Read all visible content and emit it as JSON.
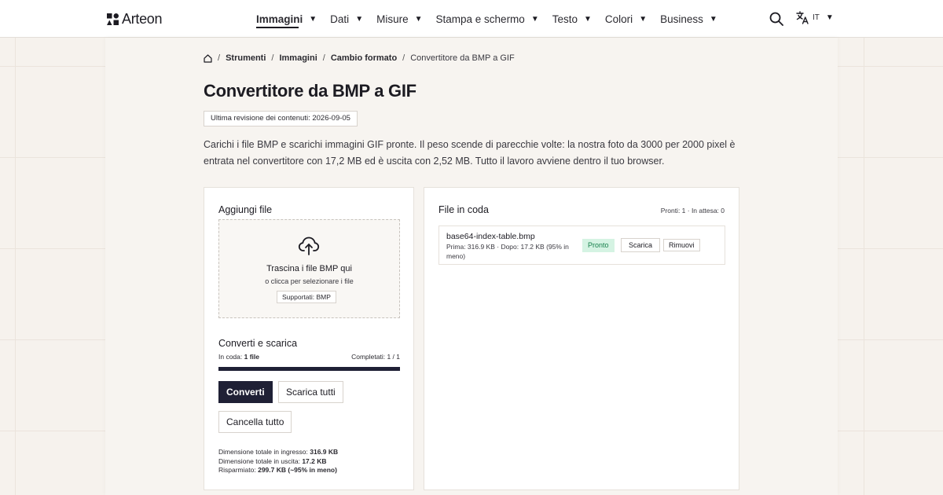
{
  "header": {
    "brand": "Arteon",
    "nav": [
      {
        "label": "Immagini",
        "active": true
      },
      {
        "label": "Dati"
      },
      {
        "label": "Misure"
      },
      {
        "label": "Stampa e schermo"
      },
      {
        "label": "Testo"
      },
      {
        "label": "Colori"
      },
      {
        "label": "Business"
      }
    ],
    "caret": "▼",
    "language": "IT",
    "icons": {
      "search": "search-icon",
      "translate": "translate-icon",
      "home": "home-icon"
    }
  },
  "breadcrumb": {
    "separator": "/",
    "items": [
      "Strumenti",
      "Immagini",
      "Cambio formato"
    ],
    "current": "Convertitore da BMP a GIF"
  },
  "page": {
    "title": "Convertitore da BMP a GIF",
    "revision": "Ultima revisione dei contenuti: 2026-09-05",
    "intro": "Carichi i file BMP e scarichi immagini GIF pronte. Il peso scende di parecchie volte: la nostra foto da 3000 per 2000 pixel è entrata nel convertitore con 17,2 MB ed è uscita con 2,52 MB. Tutto il lavoro avviene dentro il tuo browser."
  },
  "upload": {
    "title": "Aggiungi file",
    "drop_main": "Trascina i file BMP qui",
    "drop_sub": "o clicca per selezionare i file",
    "supported": "Supportati: BMP"
  },
  "convert": {
    "title": "Converti e scarica",
    "queued_label": "In coda:",
    "queued_value": "1 file",
    "completed": "Completati: 1 / 1",
    "progress": 1.0,
    "btn_convert": "Converti",
    "btn_download_all": "Scarica tutti",
    "btn_cancel_all": "Cancella tutto",
    "totals": [
      {
        "label": "Dimensione totale in ingresso:",
        "value": "316.9 KB"
      },
      {
        "label": "Dimensione totale in uscita:",
        "value": "17.2 KB"
      },
      {
        "label": "Risparmiato:",
        "value": "299.7 KB (~95% in meno)"
      }
    ]
  },
  "queue": {
    "title": "File in coda",
    "counts": "Pronti: 1 · In attesa: 0",
    "files": [
      {
        "name": "base64-index-table.bmp",
        "meta": "Prima: 316.9 KB · Dopo: 17.2 KB (95% in meno)",
        "status": "Pronto",
        "btn_download": "Scarica",
        "btn_remove": "Rimuovi"
      }
    ]
  },
  "colors": {
    "background": "#f6f2ed",
    "primary": "#1f2035",
    "status_ready_bg": "#d5f3e3",
    "status_ready_text": "#17804c"
  }
}
